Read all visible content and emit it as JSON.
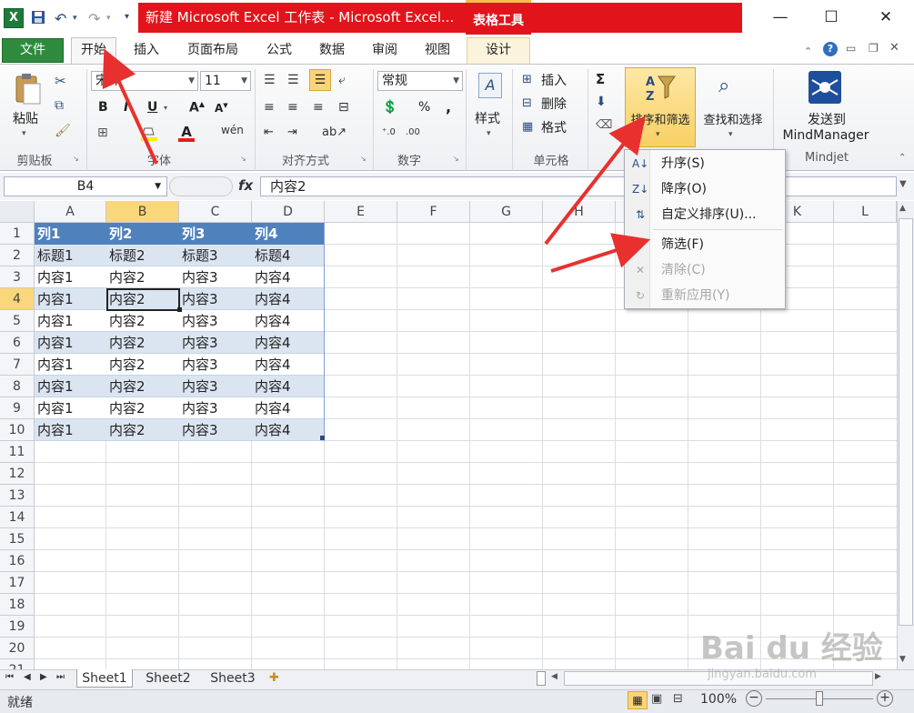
{
  "titlebar": {
    "app_logo": "X",
    "title": "新建 Microsoft Excel 工作表 - Microsoft Excel...",
    "context_title": "表格工具",
    "min_icon": "—",
    "max_icon": "☐",
    "close_icon": "✕"
  },
  "tabs": [
    "文件",
    "开始",
    "插入",
    "页面布局",
    "公式",
    "数据",
    "审阅",
    "视图",
    "设计"
  ],
  "ribbon": {
    "paste_label": "粘贴",
    "clipboard_group": "剪贴板",
    "font_name": "宋体",
    "font_size": "11",
    "font_group": "字体",
    "align_group": "对齐方式",
    "number_format": "常规",
    "number_group": "数字",
    "styles_label": "样式",
    "insert_label": "插入",
    "delete_label": "删除",
    "format_label": "格式",
    "cells_group": "单元格",
    "sort_filter_label": "排序和筛选",
    "find_select_label": "查找和选择",
    "send_label_1": "发送到",
    "send_label_2": "MindManager",
    "mindjet_group": "Mindjet",
    "bold": "B",
    "italic": "I",
    "underline": "U",
    "sigma": "Σ"
  },
  "formula_bar": {
    "name_box": "B4",
    "fx": "fx",
    "content": "内容2"
  },
  "columns": [
    "A",
    "B",
    "C",
    "D",
    "E",
    "F",
    "G",
    "H",
    "I",
    "J",
    "K",
    "L"
  ],
  "rows": [
    "1",
    "2",
    "3",
    "4",
    "5",
    "6",
    "7",
    "8",
    "9",
    "10",
    "11",
    "12",
    "13",
    "14",
    "15",
    "16",
    "17",
    "18",
    "19",
    "20",
    "21"
  ],
  "table": {
    "header": [
      "列1",
      "列2",
      "列3",
      "列4"
    ],
    "rows": [
      [
        "标题1",
        "标题2",
        "标题3",
        "标题4"
      ],
      [
        "内容1",
        "内容2",
        "内容3",
        "内容4"
      ],
      [
        "内容1",
        "内容2",
        "内容3",
        "内容4"
      ],
      [
        "内容1",
        "内容2",
        "内容3",
        "内容4"
      ],
      [
        "内容1",
        "内容2",
        "内容3",
        "内容4"
      ],
      [
        "内容1",
        "内容2",
        "内容3",
        "内容4"
      ],
      [
        "内容1",
        "内容2",
        "内容3",
        "内容4"
      ],
      [
        "内容1",
        "内容2",
        "内容3",
        "内容4"
      ],
      [
        "内容1",
        "内容2",
        "内容3",
        "内容4"
      ]
    ]
  },
  "sort_menu": {
    "items": [
      {
        "label": "升序(S)",
        "icon": "sort-asc-icon",
        "glyph": "A↓",
        "disabled": false
      },
      {
        "label": "降序(O)",
        "icon": "sort-desc-icon",
        "glyph": "Z↓",
        "disabled": false
      },
      {
        "label": "自定义排序(U)...",
        "icon": "custom-sort-icon",
        "glyph": "⇅",
        "disabled": false
      },
      {
        "label": "筛选(F)",
        "icon": "filter-icon",
        "glyph": "▼",
        "disabled": false
      },
      {
        "label": "清除(C)",
        "icon": "clear-filter-icon",
        "glyph": "✕",
        "disabled": true
      },
      {
        "label": "重新应用(Y)",
        "icon": "reapply-icon",
        "glyph": "↻",
        "disabled": true
      }
    ]
  },
  "sheets": [
    "Sheet1",
    "Sheet2",
    "Sheet3"
  ],
  "status": {
    "ready": "就绪",
    "zoom": "100%"
  },
  "watermark": {
    "logo": "Bai du 经验",
    "url": "jingyan.baidu.com"
  },
  "colors": {
    "title_red": "#e2141b",
    "file_tab": "#2e8b3e",
    "table_header": "#4f81bd",
    "band": "#dbe5f1",
    "selection": "#f9d77a",
    "arrow": "#e8312f"
  }
}
